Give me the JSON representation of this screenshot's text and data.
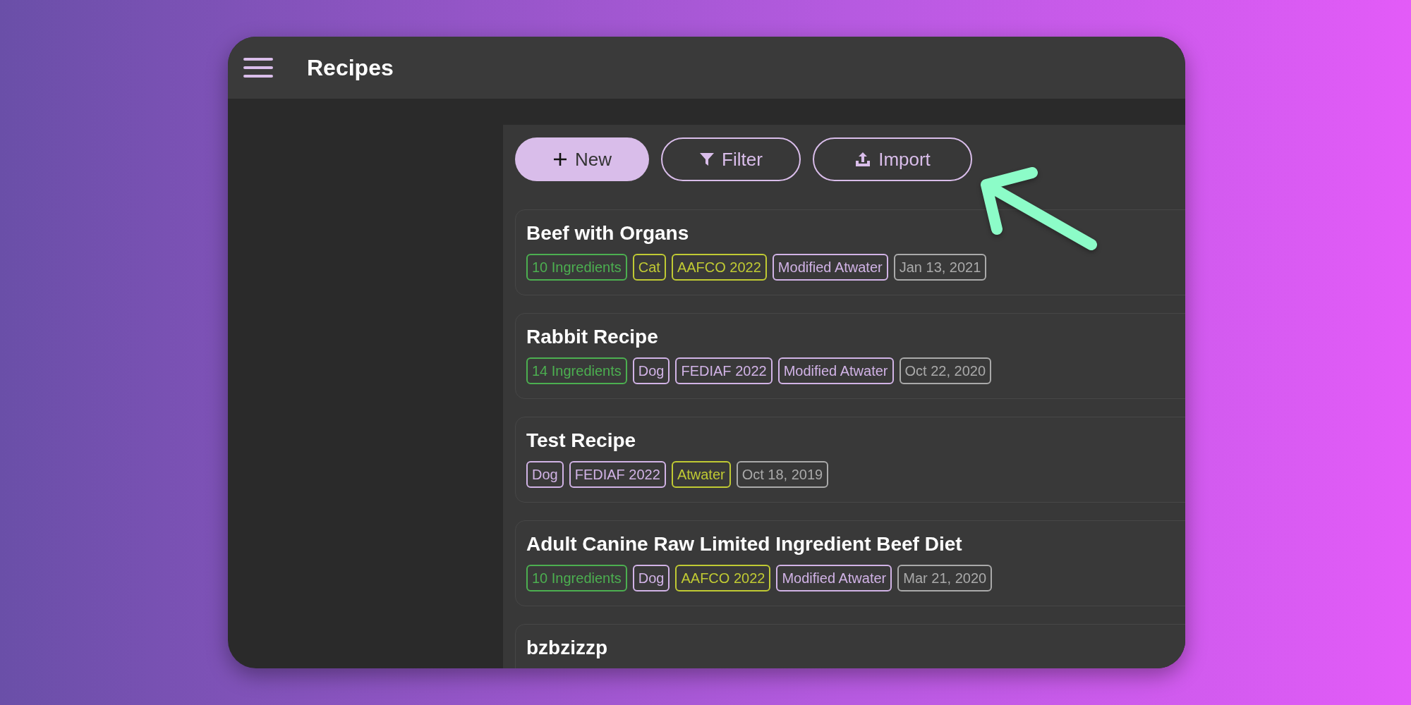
{
  "app_bar": {
    "title": "Recipes"
  },
  "toolbar": [
    {
      "kind": "new",
      "label": "New"
    },
    {
      "kind": "filter",
      "label": "Filter"
    },
    {
      "kind": "import",
      "label": "Import"
    }
  ],
  "recipes": [
    {
      "title": "Beef with Organs",
      "tags": [
        {
          "text": "10 Ingredients",
          "color": "#4caf50"
        },
        {
          "text": "Cat",
          "color": "#c0ca33"
        },
        {
          "text": "AAFCO 2022",
          "color": "#c0ca33"
        },
        {
          "text": "Modified Atwater",
          "color": "#d1b3e6"
        },
        {
          "text": "Jan 13, 2021",
          "color": "#aaaaaa"
        }
      ]
    },
    {
      "title": "Rabbit Recipe",
      "tags": [
        {
          "text": "14 Ingredients",
          "color": "#4caf50"
        },
        {
          "text": "Dog",
          "color": "#d1b3e6"
        },
        {
          "text": "FEDIAF 2022",
          "color": "#d1b3e6"
        },
        {
          "text": "Modified Atwater",
          "color": "#d1b3e6"
        },
        {
          "text": "Oct 22, 2020",
          "color": "#aaaaaa"
        }
      ]
    },
    {
      "title": "Test Recipe",
      "tags": [
        {
          "text": "Dog",
          "color": "#d1b3e6"
        },
        {
          "text": "FEDIAF 2022",
          "color": "#d1b3e6"
        },
        {
          "text": "Atwater",
          "color": "#c0ca33"
        },
        {
          "text": "Oct 18, 2019",
          "color": "#aaaaaa"
        }
      ]
    },
    {
      "title": "Adult Canine Raw Limited Ingredient Beef Diet",
      "tags": [
        {
          "text": "10 Ingredients",
          "color": "#4caf50"
        },
        {
          "text": "Dog",
          "color": "#d1b3e6"
        },
        {
          "text": "AAFCO 2022",
          "color": "#c0ca33"
        },
        {
          "text": "Modified Atwater",
          "color": "#d1b3e6"
        },
        {
          "text": "Mar 21, 2020",
          "color": "#aaaaaa"
        }
      ]
    },
    {
      "title": "bzbzizzp"
    }
  ]
}
